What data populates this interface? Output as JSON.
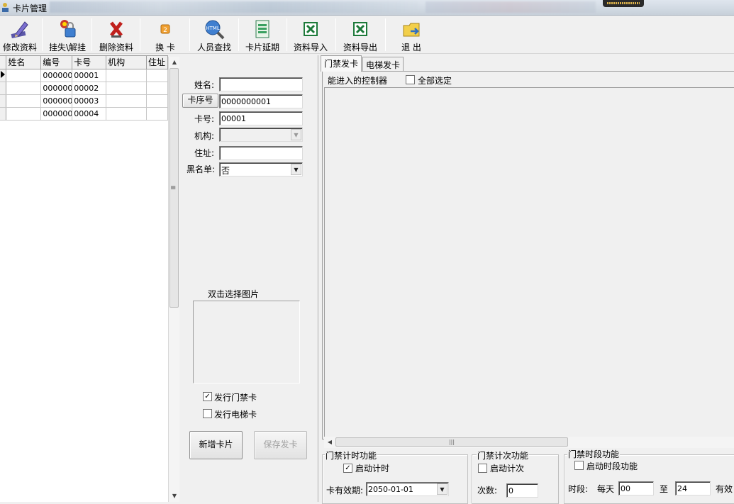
{
  "window": {
    "title": "卡片管理"
  },
  "toolbar": {
    "buttons": [
      {
        "label": "修改资料",
        "icon": "pencil-icon"
      },
      {
        "label": "挂失\\解挂",
        "icon": "lock-person-icon"
      },
      {
        "label": "删除资料",
        "icon": "delete-x-icon"
      },
      {
        "label": "换 卡",
        "icon": "swap-card-icon"
      },
      {
        "label": "人员查找",
        "icon": "html-search-icon"
      },
      {
        "label": "卡片延期",
        "icon": "document-extend-icon"
      },
      {
        "label": "资料导入",
        "icon": "excel-import-icon"
      },
      {
        "label": "资料导出",
        "icon": "excel-export-icon"
      },
      {
        "label": "退 出",
        "icon": "exit-folder-icon"
      }
    ]
  },
  "grid": {
    "columns": [
      "姓名",
      "编号",
      "卡号",
      "机构",
      "住址"
    ],
    "rows": [
      [
        "",
        "0000000",
        "00001",
        "",
        ""
      ],
      [
        "",
        "0000000",
        "00002",
        "",
        ""
      ],
      [
        "",
        "0000000",
        "00003",
        "",
        ""
      ],
      [
        "",
        "0000000",
        "00004",
        "",
        ""
      ]
    ]
  },
  "form": {
    "name_label": "姓名:",
    "name_value": "",
    "serial_button": "卡序号",
    "serial_value": "0000000001",
    "cardno_label": "卡号:",
    "cardno_value": "00001",
    "org_label": "机构:",
    "org_value": "",
    "address_label": "住址:",
    "address_value": "",
    "blacklist_label": "黑名单:",
    "blacklist_value": "否",
    "photo_label": "双击选择图片",
    "issue_door_label": "发行门禁卡",
    "issue_door_checked": true,
    "issue_elevator_label": "发行电梯卡",
    "issue_elevator_checked": false,
    "new_card_button": "新增卡片",
    "save_card_button": "保存发卡"
  },
  "tabs": [
    {
      "label": "门禁发卡",
      "active": true
    },
    {
      "label": "电梯发卡",
      "active": false
    }
  ],
  "access": {
    "controllers_label": "能进入的控制器",
    "select_all_label": "全部选定",
    "select_all_checked": false
  },
  "timing": {
    "title": "门禁计时功能",
    "enable_label": "启动计时",
    "enable_checked": true,
    "validity_label": "卡有效期:",
    "validity_value": "2050-01-01"
  },
  "counting": {
    "title": "门禁计次功能",
    "enable_label": "启动计次",
    "enable_checked": false,
    "count_label": "次数:",
    "count_value": "0"
  },
  "period": {
    "title": "门禁时段功能",
    "enable_label": "启动时段功能",
    "enable_checked": false,
    "period_label": "时段:",
    "daily_label": "每天",
    "from_value": "00",
    "to_label": "至",
    "to_value": "24",
    "valid_label": "有效"
  },
  "colors": {
    "excel_green": "#1d7a3a",
    "delete_red": "#c0201c"
  }
}
